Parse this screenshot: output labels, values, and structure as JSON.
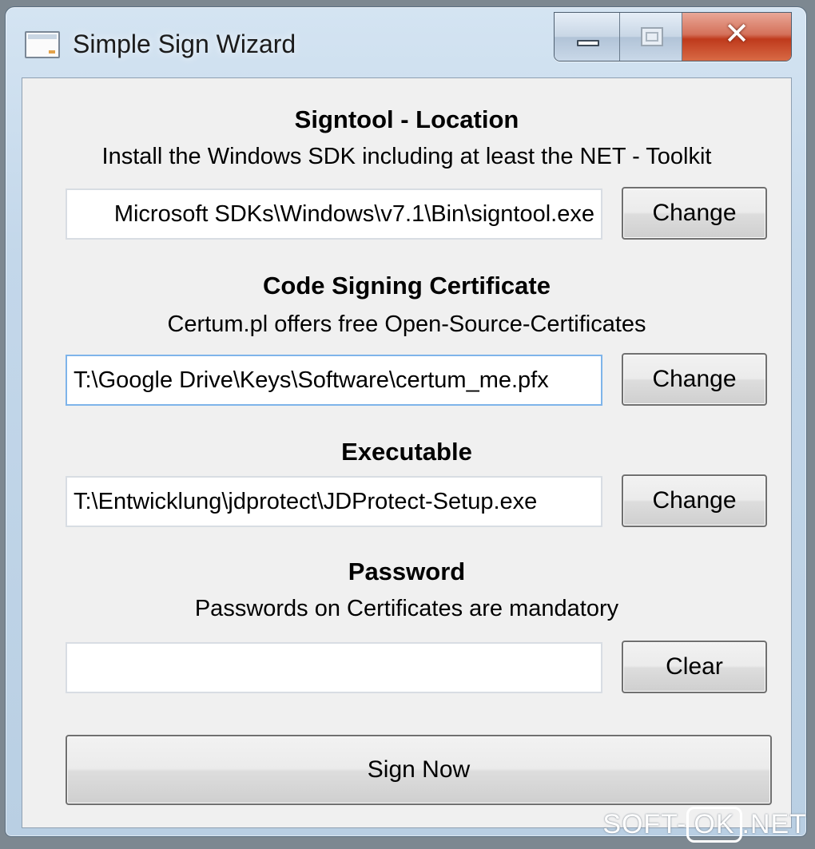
{
  "window": {
    "title": "Simple Sign Wizard",
    "icon": "app-window-icon"
  },
  "signtool": {
    "heading": "Signtool - Location",
    "hint": "Install the Windows SDK including at least the NET - Toolkit",
    "path_value": "Microsoft SDKs\\Windows\\v7.1\\Bin\\signtool.exe",
    "button_label": "Change"
  },
  "certificate": {
    "heading": "Code Signing Certificate",
    "hint": "Certum.pl offers free Open-Source-Certificates",
    "path_value": "T:\\Google Drive\\Keys\\Software\\certum_me.pfx",
    "button_label": "Change"
  },
  "executable": {
    "heading": "Executable",
    "path_value": "T:\\Entwicklung\\jdprotect\\JDProtect-Setup.exe",
    "button_label": "Change"
  },
  "password": {
    "heading": "Password",
    "hint": "Passwords on Certificates are mandatory",
    "value": "",
    "button_label": "Clear"
  },
  "actions": {
    "sign_now_label": "Sign Now"
  },
  "watermark": {
    "left": "SOFT-",
    "boxed": "OK",
    "right": ".NET"
  }
}
